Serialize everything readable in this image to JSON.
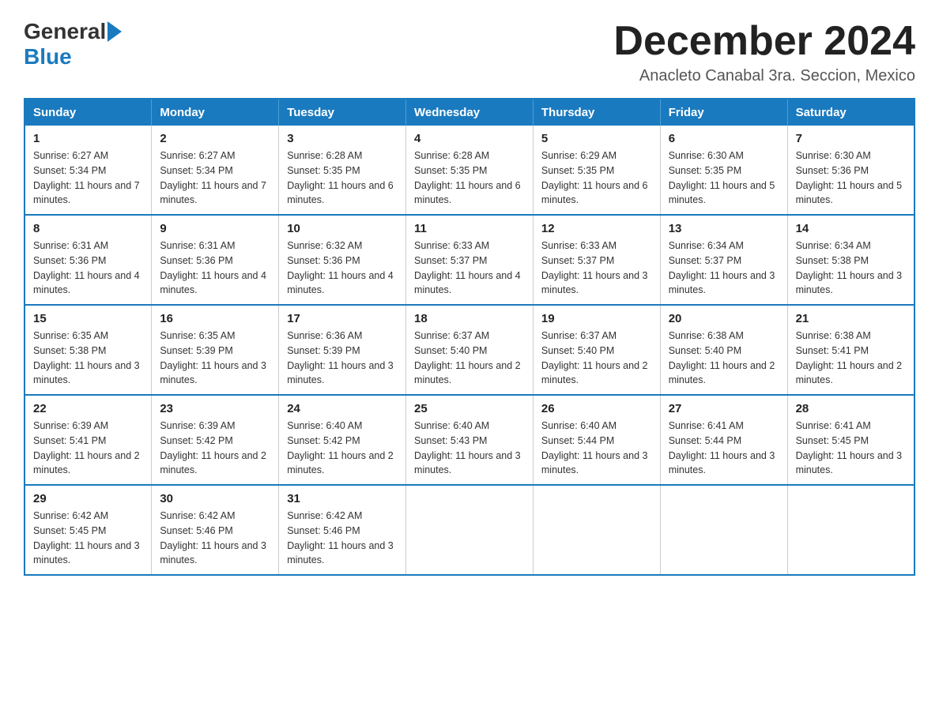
{
  "header": {
    "logo_general": "General",
    "logo_blue": "Blue",
    "main_title": "December 2024",
    "subtitle": "Anacleto Canabal 3ra. Seccion, Mexico"
  },
  "days_of_week": [
    "Sunday",
    "Monday",
    "Tuesday",
    "Wednesday",
    "Thursday",
    "Friday",
    "Saturday"
  ],
  "weeks": [
    [
      {
        "day": "1",
        "sunrise": "Sunrise: 6:27 AM",
        "sunset": "Sunset: 5:34 PM",
        "daylight": "Daylight: 11 hours and 7 minutes."
      },
      {
        "day": "2",
        "sunrise": "Sunrise: 6:27 AM",
        "sunset": "Sunset: 5:34 PM",
        "daylight": "Daylight: 11 hours and 7 minutes."
      },
      {
        "day": "3",
        "sunrise": "Sunrise: 6:28 AM",
        "sunset": "Sunset: 5:35 PM",
        "daylight": "Daylight: 11 hours and 6 minutes."
      },
      {
        "day": "4",
        "sunrise": "Sunrise: 6:28 AM",
        "sunset": "Sunset: 5:35 PM",
        "daylight": "Daylight: 11 hours and 6 minutes."
      },
      {
        "day": "5",
        "sunrise": "Sunrise: 6:29 AM",
        "sunset": "Sunset: 5:35 PM",
        "daylight": "Daylight: 11 hours and 6 minutes."
      },
      {
        "day": "6",
        "sunrise": "Sunrise: 6:30 AM",
        "sunset": "Sunset: 5:35 PM",
        "daylight": "Daylight: 11 hours and 5 minutes."
      },
      {
        "day": "7",
        "sunrise": "Sunrise: 6:30 AM",
        "sunset": "Sunset: 5:36 PM",
        "daylight": "Daylight: 11 hours and 5 minutes."
      }
    ],
    [
      {
        "day": "8",
        "sunrise": "Sunrise: 6:31 AM",
        "sunset": "Sunset: 5:36 PM",
        "daylight": "Daylight: 11 hours and 4 minutes."
      },
      {
        "day": "9",
        "sunrise": "Sunrise: 6:31 AM",
        "sunset": "Sunset: 5:36 PM",
        "daylight": "Daylight: 11 hours and 4 minutes."
      },
      {
        "day": "10",
        "sunrise": "Sunrise: 6:32 AM",
        "sunset": "Sunset: 5:36 PM",
        "daylight": "Daylight: 11 hours and 4 minutes."
      },
      {
        "day": "11",
        "sunrise": "Sunrise: 6:33 AM",
        "sunset": "Sunset: 5:37 PM",
        "daylight": "Daylight: 11 hours and 4 minutes."
      },
      {
        "day": "12",
        "sunrise": "Sunrise: 6:33 AM",
        "sunset": "Sunset: 5:37 PM",
        "daylight": "Daylight: 11 hours and 3 minutes."
      },
      {
        "day": "13",
        "sunrise": "Sunrise: 6:34 AM",
        "sunset": "Sunset: 5:37 PM",
        "daylight": "Daylight: 11 hours and 3 minutes."
      },
      {
        "day": "14",
        "sunrise": "Sunrise: 6:34 AM",
        "sunset": "Sunset: 5:38 PM",
        "daylight": "Daylight: 11 hours and 3 minutes."
      }
    ],
    [
      {
        "day": "15",
        "sunrise": "Sunrise: 6:35 AM",
        "sunset": "Sunset: 5:38 PM",
        "daylight": "Daylight: 11 hours and 3 minutes."
      },
      {
        "day": "16",
        "sunrise": "Sunrise: 6:35 AM",
        "sunset": "Sunset: 5:39 PM",
        "daylight": "Daylight: 11 hours and 3 minutes."
      },
      {
        "day": "17",
        "sunrise": "Sunrise: 6:36 AM",
        "sunset": "Sunset: 5:39 PM",
        "daylight": "Daylight: 11 hours and 3 minutes."
      },
      {
        "day": "18",
        "sunrise": "Sunrise: 6:37 AM",
        "sunset": "Sunset: 5:40 PM",
        "daylight": "Daylight: 11 hours and 2 minutes."
      },
      {
        "day": "19",
        "sunrise": "Sunrise: 6:37 AM",
        "sunset": "Sunset: 5:40 PM",
        "daylight": "Daylight: 11 hours and 2 minutes."
      },
      {
        "day": "20",
        "sunrise": "Sunrise: 6:38 AM",
        "sunset": "Sunset: 5:40 PM",
        "daylight": "Daylight: 11 hours and 2 minutes."
      },
      {
        "day": "21",
        "sunrise": "Sunrise: 6:38 AM",
        "sunset": "Sunset: 5:41 PM",
        "daylight": "Daylight: 11 hours and 2 minutes."
      }
    ],
    [
      {
        "day": "22",
        "sunrise": "Sunrise: 6:39 AM",
        "sunset": "Sunset: 5:41 PM",
        "daylight": "Daylight: 11 hours and 2 minutes."
      },
      {
        "day": "23",
        "sunrise": "Sunrise: 6:39 AM",
        "sunset": "Sunset: 5:42 PM",
        "daylight": "Daylight: 11 hours and 2 minutes."
      },
      {
        "day": "24",
        "sunrise": "Sunrise: 6:40 AM",
        "sunset": "Sunset: 5:42 PM",
        "daylight": "Daylight: 11 hours and 2 minutes."
      },
      {
        "day": "25",
        "sunrise": "Sunrise: 6:40 AM",
        "sunset": "Sunset: 5:43 PM",
        "daylight": "Daylight: 11 hours and 3 minutes."
      },
      {
        "day": "26",
        "sunrise": "Sunrise: 6:40 AM",
        "sunset": "Sunset: 5:44 PM",
        "daylight": "Daylight: 11 hours and 3 minutes."
      },
      {
        "day": "27",
        "sunrise": "Sunrise: 6:41 AM",
        "sunset": "Sunset: 5:44 PM",
        "daylight": "Daylight: 11 hours and 3 minutes."
      },
      {
        "day": "28",
        "sunrise": "Sunrise: 6:41 AM",
        "sunset": "Sunset: 5:45 PM",
        "daylight": "Daylight: 11 hours and 3 minutes."
      }
    ],
    [
      {
        "day": "29",
        "sunrise": "Sunrise: 6:42 AM",
        "sunset": "Sunset: 5:45 PM",
        "daylight": "Daylight: 11 hours and 3 minutes."
      },
      {
        "day": "30",
        "sunrise": "Sunrise: 6:42 AM",
        "sunset": "Sunset: 5:46 PM",
        "daylight": "Daylight: 11 hours and 3 minutes."
      },
      {
        "day": "31",
        "sunrise": "Sunrise: 6:42 AM",
        "sunset": "Sunset: 5:46 PM",
        "daylight": "Daylight: 11 hours and 3 minutes."
      },
      null,
      null,
      null,
      null
    ]
  ]
}
